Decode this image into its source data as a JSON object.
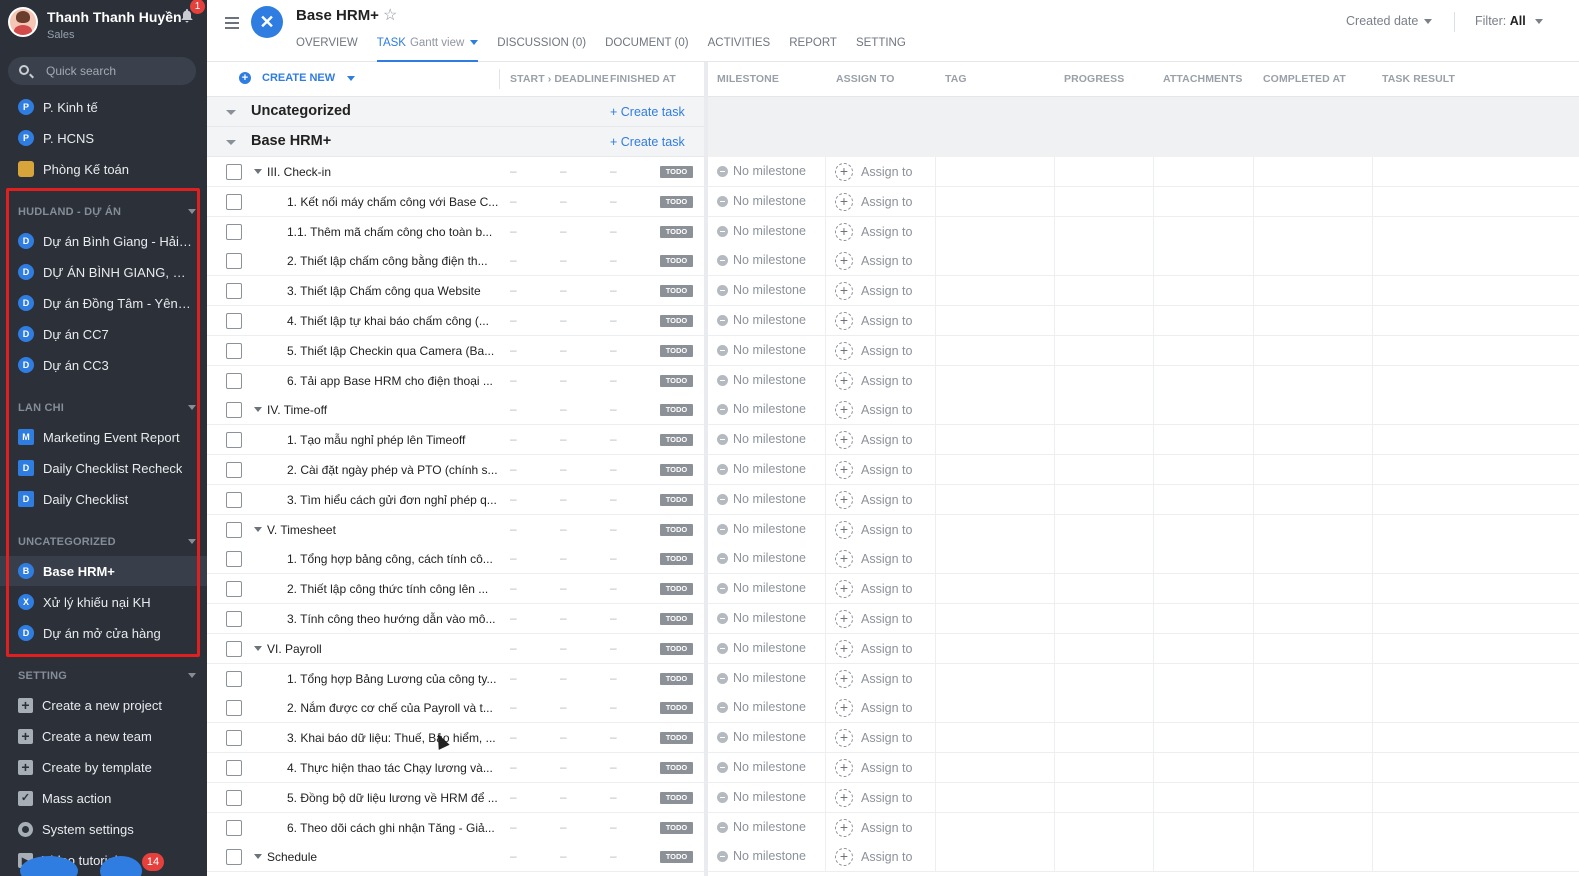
{
  "user": {
    "name": "Thanh Thanh Huyền",
    "role": "Sales",
    "notifications": "1"
  },
  "search": {
    "placeholder": "Quick search"
  },
  "sidebar": {
    "top_items": [
      {
        "icon": "P",
        "label": "P. Kinh tế"
      },
      {
        "icon": "P",
        "label": "P. HCNS"
      },
      {
        "icon": "coin",
        "label": "Phòng Kế toán"
      }
    ],
    "sections": [
      {
        "title": "HUDLAND - DỰ ÁN",
        "items": [
          {
            "icon": "D",
            "label": "Dự án Bình Giang - Hải D..."
          },
          {
            "icon": "D",
            "label": "DỰ ÁN BÌNH GIANG, HẢI ..."
          },
          {
            "icon": "D",
            "label": "Dự án Đồng Tâm - Yên Bái"
          },
          {
            "icon": "D",
            "label": "Dự án CC7"
          },
          {
            "icon": "D",
            "label": "Dự án CC3"
          }
        ]
      },
      {
        "title": "LAN CHI",
        "items": [
          {
            "icon": "M",
            "label": "Marketing Event Report"
          },
          {
            "icon": "D",
            "label": "Daily Checklist Recheck"
          },
          {
            "icon": "D",
            "label": "Daily Checklist"
          }
        ]
      },
      {
        "title": "UNCATEGORIZED",
        "items": [
          {
            "icon": "B",
            "label": "Base HRM+"
          },
          {
            "icon": "X",
            "label": "Xử lý khiếu nại KH"
          },
          {
            "icon": "D",
            "label": "Dự án mở cửa hàng"
          }
        ]
      },
      {
        "title": "SETTING",
        "items": [
          {
            "icon": "plus",
            "label": "Create a new project"
          },
          {
            "icon": "plus",
            "label": "Create a new team"
          },
          {
            "icon": "plus",
            "label": "Create by template"
          },
          {
            "icon": "check",
            "label": "Mass action"
          },
          {
            "icon": "gear",
            "label": "System settings"
          },
          {
            "icon": "video",
            "label": "Video tutorials"
          }
        ]
      }
    ],
    "bottom_badge": "14"
  },
  "header": {
    "logo_letter": "✕",
    "title": "Base HRM+",
    "tabs": [
      {
        "label": "OVERVIEW"
      },
      {
        "label": "TASK",
        "sub": "Gantt view"
      },
      {
        "label": "DISCUSSION (0)"
      },
      {
        "label": "DOCUMENT (0)"
      },
      {
        "label": "ACTIVITIES"
      },
      {
        "label": "REPORT"
      },
      {
        "label": "SETTING"
      }
    ],
    "sort_label": "Created date",
    "filter_prefix": "Filter:",
    "filter_value": "All"
  },
  "table": {
    "create_new": "CREATE NEW",
    "columns": {
      "start_deadline": "START › DEADLINE",
      "finished_at": "FINISHED AT",
      "milestone": "MILESTONE",
      "assign_to": "ASSIGN TO",
      "tag": "TAG",
      "progress": "PROGRESS",
      "attachments": "ATTACHMENTS",
      "completed_at": "COMPLETED AT",
      "task_result": "TASK RESULT"
    },
    "groups": [
      {
        "title": "Uncategorized",
        "action": "Create task"
      },
      {
        "title": "Base HRM+",
        "action": "Create task"
      }
    ],
    "dash": "–",
    "status": "TODO",
    "milestone_text": "No milestone",
    "assign_text": "Assign to",
    "rows": [
      {
        "level": 0,
        "name": "III. Check-in"
      },
      {
        "level": 1,
        "name": "1. Kết nối máy chấm công với Base C..."
      },
      {
        "level": 1,
        "name": "1.1. Thêm mã chấm công cho toàn b..."
      },
      {
        "level": 1,
        "name": "2. Thiết lập chấm công bằng điện th..."
      },
      {
        "level": 1,
        "name": "3. Thiết lập Chấm công qua Website"
      },
      {
        "level": 1,
        "name": "4. Thiết lập tự khai báo chấm công (..."
      },
      {
        "level": 1,
        "name": "5. Thiết lập Checkin qua Camera (Ba..."
      },
      {
        "level": 1,
        "name": "6. Tải app Base HRM cho điện thoại ..."
      },
      {
        "level": 0,
        "name": "IV. Time-off"
      },
      {
        "level": 1,
        "name": "1. Tạo mẫu nghỉ phép lên Timeoff"
      },
      {
        "level": 1,
        "name": "2. Cài đặt ngày phép và PTO (chính s..."
      },
      {
        "level": 1,
        "name": "3. Tìm hiểu cách gửi đơn nghỉ phép q..."
      },
      {
        "level": 0,
        "name": "V. Timesheet"
      },
      {
        "level": 1,
        "name": "1. Tổng hợp bảng công, cách tính cô..."
      },
      {
        "level": 1,
        "name": "2. Thiết lập công thức tính công lên ..."
      },
      {
        "level": 1,
        "name": "3. Tính công theo hướng dẫn vào mô..."
      },
      {
        "level": 0,
        "name": "VI. Payroll"
      },
      {
        "level": 1,
        "name": "1. Tổng hợp Bảng Lương của công ty..."
      },
      {
        "level": 1,
        "name": "2. Nắm được cơ chế của Payroll và t..."
      },
      {
        "level": 1,
        "name": "3. Khai báo dữ liệu: Thuế, Bảo hiểm, ..."
      },
      {
        "level": 1,
        "name": "4. Thực hiện thao tác Chạy lương và..."
      },
      {
        "level": 1,
        "name": "5. Đồng bộ dữ liệu lương về HRM để ..."
      },
      {
        "level": 1,
        "name": "6. Theo dõi cách ghi nhận Tăng - Giả..."
      },
      {
        "level": 0,
        "name": "Schedule"
      }
    ]
  },
  "colors": {
    "sidebar_bg": "#2b3039",
    "accent": "#2f7de1",
    "highlight_border": "#e02020",
    "todo_badge": "#8c9198"
  }
}
